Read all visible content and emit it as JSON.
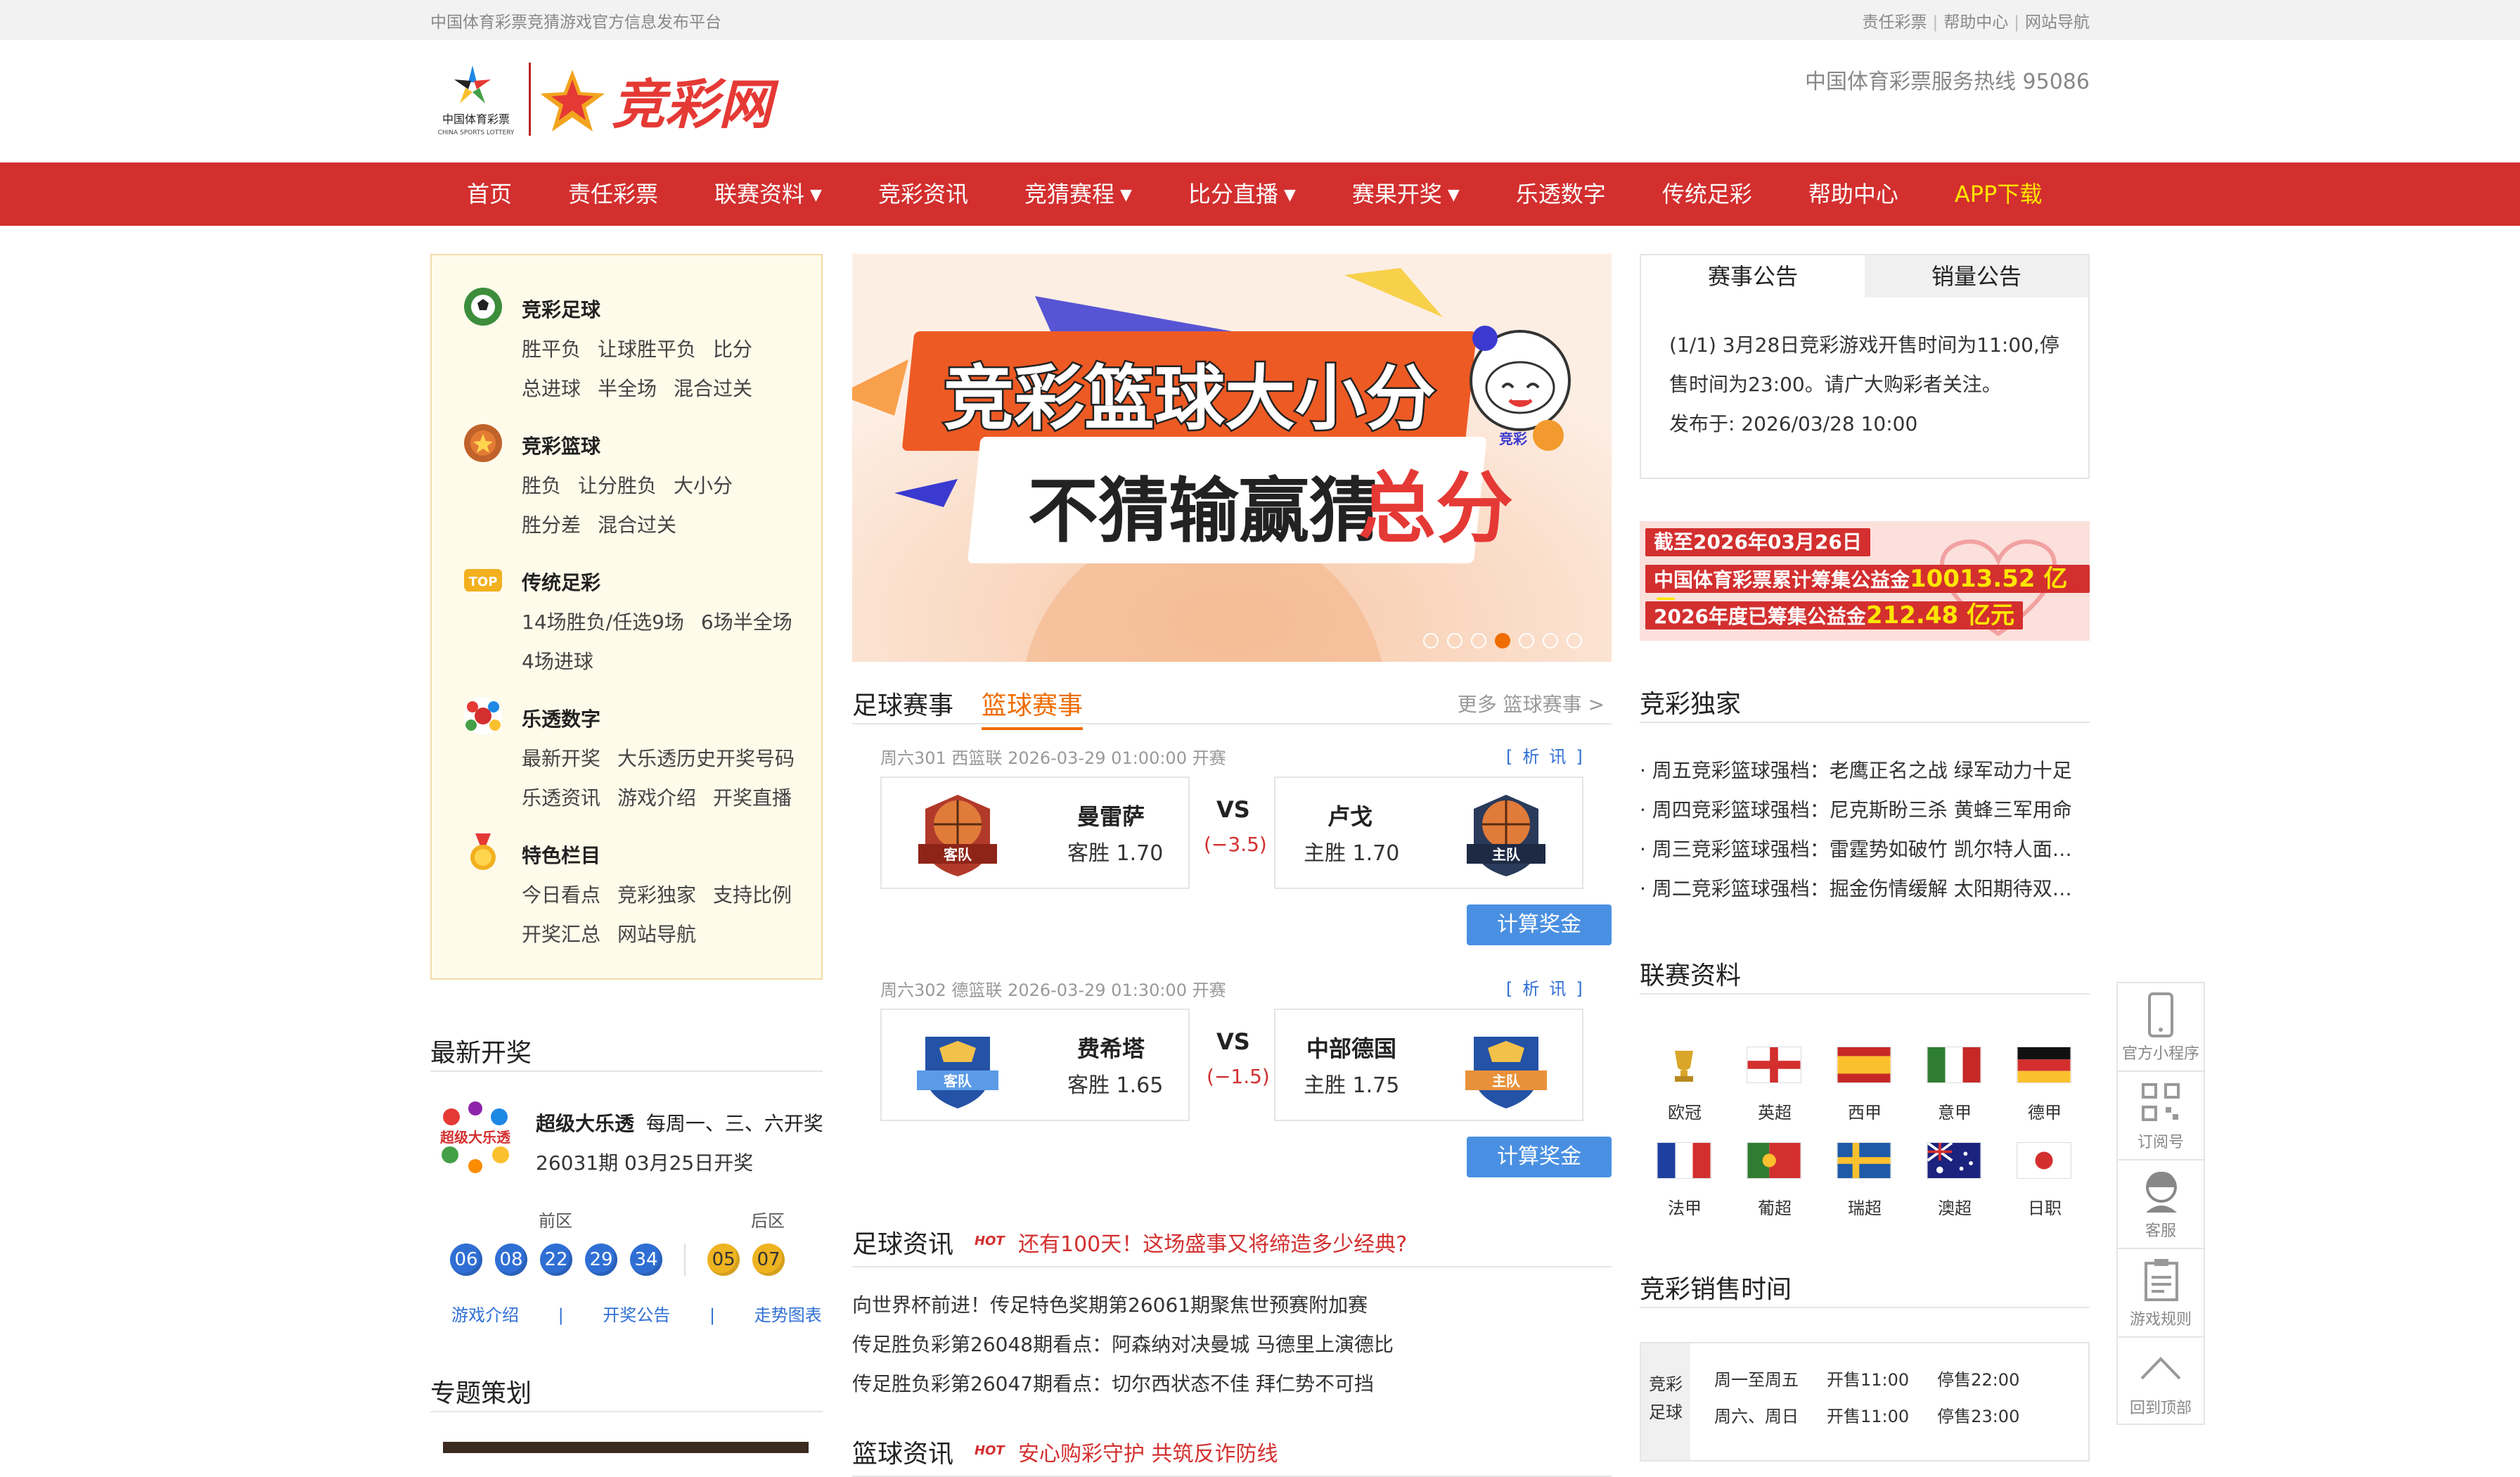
{
  "topbar": {
    "site_desc": "中国体育彩票竞猜游戏官方信息发布平台",
    "links": [
      "责任彩票",
      "帮助中心",
      "网站导航"
    ]
  },
  "header": {
    "logo_cn": "中国体育彩票",
    "logo_en": "CHINA SPORTS LOTTERY",
    "brand": "竞彩网",
    "hotline": "中国体育彩票服务热线 95086"
  },
  "nav": {
    "items": [
      "首页",
      "责任彩票",
      "联赛资料",
      "竞彩资讯",
      "竞猜赛程",
      "比分直播",
      "赛果开奖",
      "乐透数字",
      "传统足彩",
      "帮助中心",
      "APP下载"
    ],
    "caret": "▼"
  },
  "categories": [
    {
      "title": "竞彩足球",
      "lines": [
        [
          "胜平负",
          "让球胜平负",
          "比分"
        ],
        [
          "总进球",
          "半全场",
          "混合过关"
        ]
      ]
    },
    {
      "title": "竞彩篮球",
      "lines": [
        [
          "胜负",
          "让分胜负",
          "大小分"
        ],
        [
          "胜分差",
          "混合过关"
        ]
      ]
    },
    {
      "title": "传统足彩",
      "lines": [
        [
          "14场胜负/任选9场",
          "6场半全场"
        ],
        [
          "4场进球"
        ]
      ]
    },
    {
      "title": "乐透数字",
      "lines": [
        [
          "最新开奖",
          "大乐透历史开奖号码"
        ],
        [
          "乐透资讯",
          "游戏介绍",
          "开奖直播"
        ]
      ]
    },
    {
      "title": "特色栏目",
      "lines": [
        [
          "今日看点",
          "竞彩独家",
          "支持比例"
        ],
        [
          "开奖汇总",
          "网站导航"
        ]
      ]
    }
  ],
  "latest_draw": {
    "section_title": "最新开奖",
    "logo_text": "超级大乐透",
    "game": "超级大乐透",
    "schedule": "每周一、三、六开奖",
    "issue": "26031期 03月25日开奖",
    "front_label": "前区",
    "back_label": "后区",
    "front": [
      "06",
      "08",
      "22",
      "29",
      "34"
    ],
    "back": [
      "05",
      "07"
    ],
    "links": [
      "游戏介绍",
      "开奖公告",
      "走势图表"
    ],
    "link_sep": "|"
  },
  "special": {
    "section_title": "专题策划"
  },
  "banner": {
    "line1": "竞彩篮球大小分",
    "line2a": "不猜输赢猜",
    "line2b": "总分",
    "tag": "竞彩"
  },
  "match_tabs": {
    "tabs": [
      "足球赛事",
      "篮球赛事"
    ],
    "more": "更多 篮球赛事 >"
  },
  "matches": [
    {
      "info": "周六301 西篮联 2026-03-29 01:00:00 开赛",
      "news": "[析讯]",
      "away_badge": "客队",
      "away": "曼雷萨",
      "away_odds": "客胜 1.70",
      "vs": "VS",
      "handicap": "(−3.5)",
      "home": "卢戈",
      "home_odds": "主胜 1.70",
      "home_badge": "主队",
      "calc": "计算奖金"
    },
    {
      "info": "周六302 德篮联 2026-03-29 01:30:00 开赛",
      "news": "[析讯]",
      "away_badge": "客队",
      "away": "费希塔",
      "away_odds": "客胜 1.65",
      "vs": "VS",
      "handicap": "(−1.5)",
      "home": "中部德国",
      "home_odds": "主胜 1.75",
      "home_badge": "主队",
      "calc": "计算奖金"
    }
  ],
  "football_news": {
    "title": "足球资讯",
    "hot_label": "HOT",
    "headline": "还有100天！这场盛事又将缔造多少经典?",
    "items": [
      "向世界杯前进！传足特色奖期第26061期聚焦世预赛附加赛",
      "传足胜负彩第26048期看点：阿森纳对决曼城 马德里上演德比",
      "传足胜负彩第26047期看点：切尔西状态不佳 拜仁势不可挡"
    ]
  },
  "basketball_news": {
    "title": "篮球资讯",
    "headline": "安心购彩守护 共筑反诈防线"
  },
  "notice": {
    "tabs": [
      "赛事公告",
      "销量公告"
    ],
    "text": "(1/1) 3月28日竞彩游戏开售时间为11:00,停售时间为23:00。请广大购彩者关注。",
    "date": "发布于: 2026/03/28 10:00"
  },
  "welfare": {
    "line1": "截至2026年03月26日",
    "line2_label": "中国体育彩票累计筹集公益金",
    "line2_value": "10013.52 亿元",
    "line3_label": "2026年度已筹集公益金",
    "line3_value": "212.48 亿元"
  },
  "exclusive": {
    "title": "竞彩独家",
    "items": [
      "· 周五竞彩篮球强档：老鹰正名之战 绿军动力十足",
      "· 周四竞彩篮球强档：尼克斯盼三杀 黄蜂三军用命",
      "· 周三竞彩篮球强档：雷霆势如破竹 凯尔特人面…",
      "· 周二竞彩篮球强档：掘金伤情缓解 太阳期待双…"
    ]
  },
  "leagues": {
    "title": "联赛资料",
    "items": [
      "欧冠",
      "英超",
      "西甲",
      "意甲",
      "德甲",
      "法甲",
      "葡超",
      "瑞超",
      "澳超",
      "日职"
    ]
  },
  "sale_time": {
    "title": "竞彩销售时间",
    "label": "竞彩足球",
    "rows": [
      {
        "days": "周一至周五",
        "open": "开售11:00",
        "close": "停售22:00"
      },
      {
        "days": "周六、周日",
        "open": "开售11:00",
        "close": "停售23:00"
      }
    ]
  },
  "float_bar": [
    "官方小程序",
    "订阅号",
    "客服",
    "游戏规则",
    "回到顶部"
  ],
  "colors": {
    "brand_red": "#d32f2f",
    "accent_orange": "#ef6c00",
    "link_blue": "#2f6fd4",
    "app_yellow": "#ffe600"
  }
}
